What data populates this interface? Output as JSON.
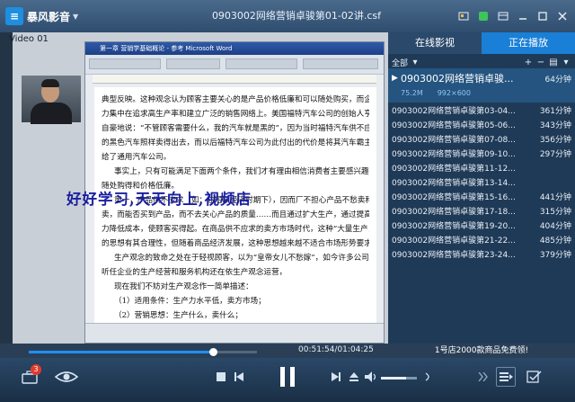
{
  "app": {
    "name": "暴风影音",
    "file_title": "0903002网络营销卓骏第01-02讲.csf"
  },
  "video": {
    "label": "Video 01",
    "watermark": "好好学习,天天向上,视频店",
    "word_title": "第一章 营销学基础概论 - 参考 Microsoft Word",
    "page_lines": [
      "典型反映。这种观念认为顾客主要关心的是产品价格低廉和可以随处购买，而企业则把注意",
      "力集中在追求高生产率和建立广泛的销售网络上。美国福特汽车公司的创始人亨利·福特曾",
      "自豪地说：“不管顾客需要什么，我的汽车就是黑的”，因为当时福特汽车供不应求，满一色",
      "的黑色汽车照样卖得出去，而以后福特汽车公司为此付出的代价是将其汽车霸主地位拱手让",
      "给了通用汽车公司。",
      "事实上，只有可能满足下面两个条件，我们才有理由相信消费者主要感兴趣的是产品可",
      "随处购得和价格低廉。",
      "第一，产品供不应求（如：在短缺经济时期下），因而厂不担心产品不愁卖和获得产品出",
      "卖，而能否买到产品，而不去关心产品的质量……而且通过扩大生产，通过提高生产",
      "力降低成本，使顾客买得起。在商品供不应求的卖方市场时代，这种“大量生产，降低价格”",
      "的思想有其合理性，但随着商品经济发展，这种思想越来越不适合市场形势要求。",
      "生产观念的致命之处在于轻视顾客，以为“皇帝女儿不愁嫁”，如今许多公司事业，若",
      "听任企业的生产经营和服务机构还在依生产观念运营，",
      "现在我们不妨对生产观念作一简单描述：",
      "（1）适用条件：生产力水平低，卖方市场；",
      "（2）营销思想：生产什么，卖什么；"
    ]
  },
  "panel": {
    "tab_online": "在线影视",
    "tab_playing": "正在播放",
    "filter": "全部",
    "current": {
      "title": "0903002网络营销卓骏...",
      "duration": "64分钟",
      "size": "75.2M",
      "resolution": "992×600"
    },
    "items": [
      {
        "title": "0903002网络营销卓骏第03-04...",
        "duration": "361分钟"
      },
      {
        "title": "0903002网络营销卓骏第05-06...",
        "duration": "343分钟"
      },
      {
        "title": "0903002网络营销卓骏第07-08...",
        "duration": "356分钟"
      },
      {
        "title": "0903002网络营销卓骏第09-10...",
        "duration": "297分钟"
      },
      {
        "title": "0903002网络营销卓骏第11-12...",
        "duration": ""
      },
      {
        "title": "0903002网络营销卓骏第13-14...",
        "duration": ""
      },
      {
        "title": "0903002网络营销卓骏第15-16...",
        "duration": "441分钟"
      },
      {
        "title": "0903002网络营销卓骏第17-18...",
        "duration": "315分钟"
      },
      {
        "title": "0903002网络营销卓骏第19-20...",
        "duration": "404分钟"
      },
      {
        "title": "0903002网络营销卓骏第21-22...",
        "duration": "485分钟"
      },
      {
        "title": "0903002网络营销卓骏第23-24...",
        "duration": "379分钟"
      }
    ]
  },
  "player": {
    "time": "00:51:54/01:04:25",
    "progress": 0.806,
    "volume": 0.7,
    "promo": "1号店2000款商品免费领!",
    "badge": "3"
  },
  "icons": {
    "title": [
      "minimize-icon",
      "maximize-icon",
      "close-icon"
    ],
    "controls": [
      "toolbox-icon",
      "eye-icon",
      "stop-icon",
      "prev-icon",
      "pause-icon",
      "next-icon",
      "eject-icon",
      "volume-icon",
      "playlist-icon",
      "settings-icon"
    ]
  },
  "colors": {
    "accent": "#1a7fd6",
    "watermark": "#1a1fa0",
    "badge": "#e03a2e"
  }
}
